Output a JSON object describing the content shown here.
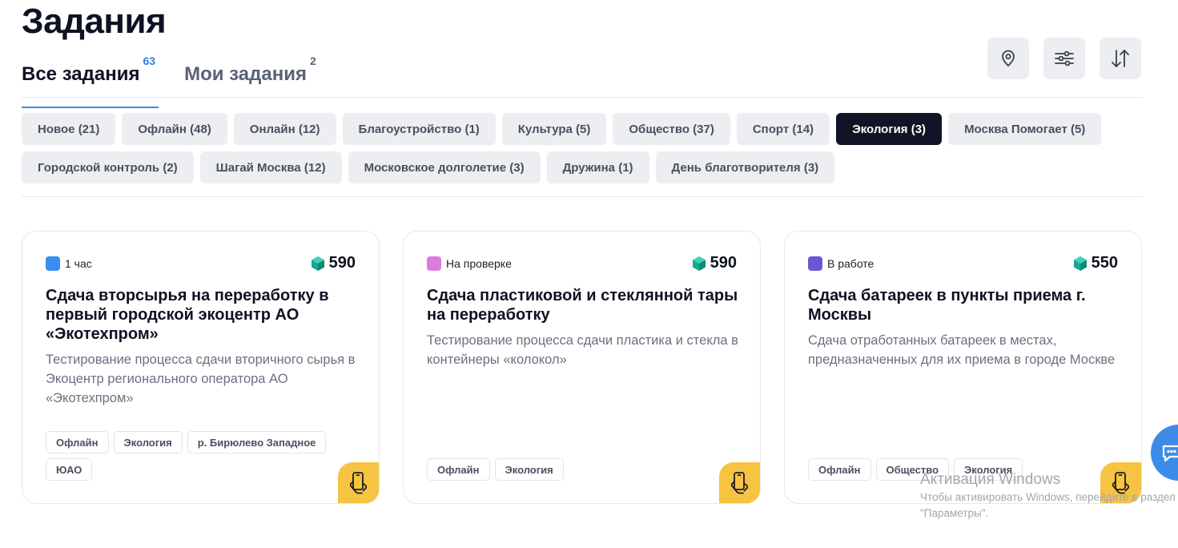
{
  "page": {
    "title": "Задания"
  },
  "tabs": [
    {
      "label": "Все задания",
      "count": "63",
      "active": true
    },
    {
      "label": "Мои задания",
      "count": "2",
      "active": false
    }
  ],
  "toolbar": {
    "icons": [
      "location-pin-icon",
      "filter-sliders-icon",
      "sort-arrows-icon"
    ]
  },
  "categories": [
    {
      "label": "Новое (21)",
      "active": false
    },
    {
      "label": "Офлайн (48)",
      "active": false
    },
    {
      "label": "Онлайн (12)",
      "active": false
    },
    {
      "label": "Благоустройство (1)",
      "active": false
    },
    {
      "label": "Культура (5)",
      "active": false
    },
    {
      "label": "Общество (37)",
      "active": false
    },
    {
      "label": "Спорт (14)",
      "active": false
    },
    {
      "label": "Экология (3)",
      "active": true
    },
    {
      "label": "Москва Помогает (5)",
      "active": false
    },
    {
      "label": "Городской контроль (2)",
      "active": false
    },
    {
      "label": "Шагай Москва (12)",
      "active": false
    },
    {
      "label": "Московское долголетие (3)",
      "active": false
    },
    {
      "label": "Дружина (1)",
      "active": false
    },
    {
      "label": "День благотворителя (3)",
      "active": false
    }
  ],
  "cards": [
    {
      "status": "1 час",
      "status_color": "#3b8cf0",
      "points": "590",
      "title": "Сдача вторсырья на переработку в первый городской экоцентр АО «Экотехпром»",
      "description": "Тестирование процесса сдачи вторичного сырья в Экоцентр регионального оператора АО «Экотехпром»",
      "tags": [
        "Офлайн",
        "Экология",
        "р. Бирюлево Западное",
        "ЮАО"
      ],
      "badge_icon": "phone-hand-icon"
    },
    {
      "status": "На проверке",
      "status_color": "#d97ddb",
      "points": "590",
      "title": "Сдача пластиковой и стеклянной тары на переработку",
      "description": "Тестирование процесса сдачи пластика и стекла в контейнеры «колокол»",
      "tags": [
        "Офлайн",
        "Экология"
      ],
      "badge_icon": "phone-hand-icon"
    },
    {
      "status": "В работе",
      "status_color": "#6b57d2",
      "points": "550",
      "title": "Сдача батареек в пункты приема г. Москвы",
      "description": "Сдача отработанных батареек в местах, предназначенных для их приема в городе Москве",
      "tags": [
        "Офлайн",
        "Общество",
        "Экология"
      ],
      "badge_icon": "phone-hand-icon"
    }
  ],
  "colors": {
    "accent": "#3d8be8",
    "active_chip": "#111427",
    "badge": "#f6c343",
    "points_gem": "#16a892"
  },
  "windows_watermark": {
    "title": "Активация Windows",
    "line1": "Чтобы активировать Windows, перейдите в раздел",
    "line2": "\"Параметры\"."
  }
}
